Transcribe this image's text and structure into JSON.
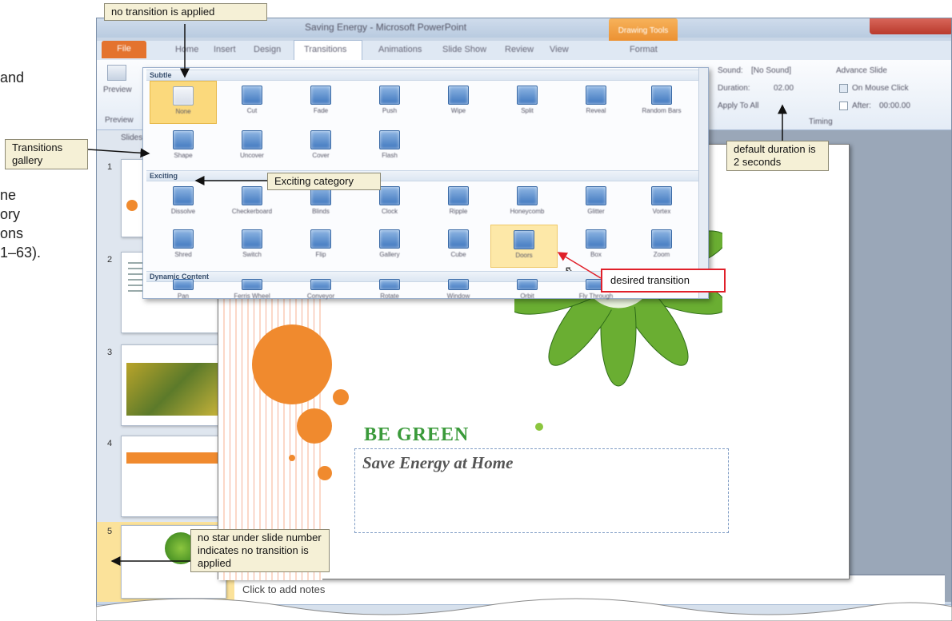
{
  "margin_text": {
    "line1": "and",
    "line2": "ne",
    "line3": "ory",
    "line4": "ons",
    "line5": "1–63)."
  },
  "window": {
    "title": "Saving Energy - Microsoft PowerPoint",
    "context_tab": "Drawing Tools",
    "tabs": [
      "File",
      "Home",
      "Insert",
      "Design",
      "Transitions",
      "Animations",
      "Slide Show",
      "Review",
      "View",
      "Format"
    ]
  },
  "ribbon": {
    "preview_label": "Preview",
    "sound_label": "Sound:",
    "sound_value": "[No Sound]",
    "duration_label": "Duration:",
    "duration_value": "02.00",
    "apply_all_label": "Apply To All",
    "advance_label": "Advance Slide",
    "on_mouse_click_label": "On Mouse Click",
    "after_label": "After:",
    "after_value": "00:00.00",
    "timing_group": "Timing",
    "preview_group": "Preview",
    "slides_tab": "Slides"
  },
  "gallery": {
    "categories": [
      "Subtle",
      "Exciting",
      "Dynamic Content"
    ],
    "subtle": [
      "None",
      "Cut",
      "Fade",
      "Push",
      "Wipe",
      "Split",
      "Reveal",
      "Random Bars",
      "Shape",
      "Uncover",
      "Cover",
      "Flash"
    ],
    "exciting": [
      "Dissolve",
      "Checkerboard",
      "Blinds",
      "Clock",
      "Ripple",
      "Honeycomb",
      "Glitter",
      "Vortex",
      "Shred",
      "Switch",
      "Flip",
      "Gallery",
      "Cube",
      "Doors",
      "Box",
      "Zoom"
    ],
    "dynamic": [
      "Pan",
      "Ferris Wheel",
      "Conveyor",
      "Rotate",
      "Window",
      "Orbit",
      "Fly Through"
    ]
  },
  "slide": {
    "title": "BE GREEN",
    "subtitle": "Save Energy at Home"
  },
  "notes_placeholder": "Click to add notes",
  "slide_numbers": [
    "1",
    "2",
    "3",
    "4",
    "5"
  ],
  "callouts": {
    "no_transition": "no transition is applied",
    "transitions_gallery": "Transitions gallery",
    "exciting_category": "Exciting category",
    "default_duration": "default duration is 2 seconds",
    "desired_transition": "desired transition",
    "no_star": "no star under slide number indicates no transition is applied"
  },
  "colors": {
    "accent_orange": "#f08a2e",
    "callout_bg": "#f5f0d6",
    "callout_red_border": "#e0202a",
    "green": "#3a9a3a"
  }
}
